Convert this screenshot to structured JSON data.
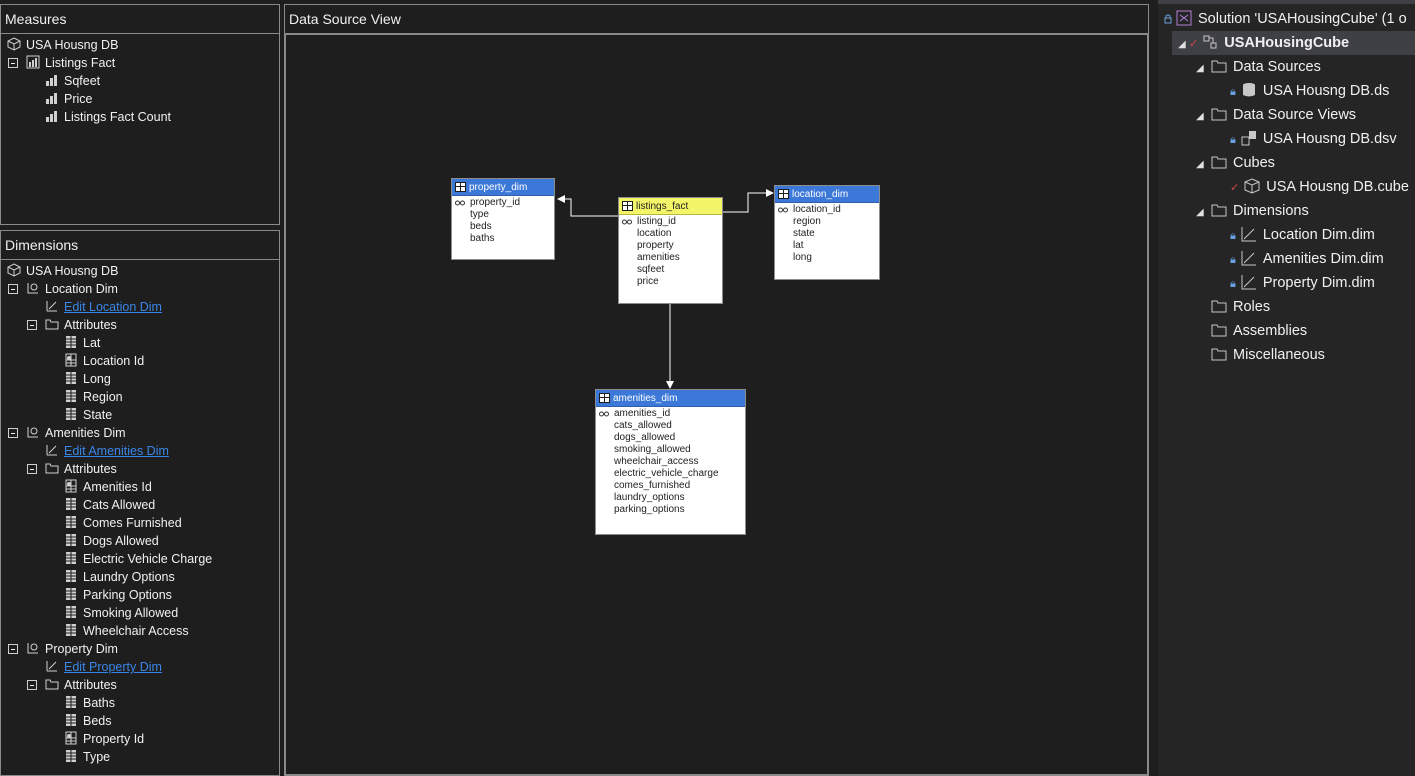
{
  "measures": {
    "header": "Measures",
    "db": "USA Housng DB",
    "group": "Listings Fact",
    "items": [
      "Sqfeet",
      "Price",
      "Listings Fact Count"
    ]
  },
  "dimensions": {
    "header": "Dimensions",
    "db": "USA Housng DB",
    "dims": [
      {
        "name": "Location Dim",
        "edit": "Edit Location Dim",
        "attributes_label": "Attributes",
        "attributes": [
          "Lat",
          "Location Id",
          "Long",
          "Region",
          "State"
        ]
      },
      {
        "name": "Amenities Dim",
        "edit": "Edit Amenities Dim",
        "attributes_label": "Attributes",
        "attributes": [
          "Amenities Id",
          "Cats Allowed",
          "Comes Furnished",
          "Dogs Allowed",
          "Electric Vehicle Charge",
          "Laundry Options",
          "Parking Options",
          "Smoking Allowed",
          "Wheelchair Access"
        ]
      },
      {
        "name": "Property Dim",
        "edit": "Edit Property Dim",
        "attributes_label": "Attributes",
        "attributes": [
          "Baths",
          "Beds",
          "Property Id",
          "Type"
        ]
      }
    ]
  },
  "dsv": {
    "header": "Data Source View",
    "tables": {
      "property_dim": {
        "name": "property_dim",
        "cols": [
          "property_id",
          "type",
          "beds",
          "baths"
        ]
      },
      "listings_fact": {
        "name": "listings_fact",
        "cols": [
          "listing_id",
          "location",
          "property",
          "amenities",
          "sqfeet",
          "price"
        ]
      },
      "location_dim": {
        "name": "location_dim",
        "cols": [
          "location_id",
          "region",
          "state",
          "lat",
          "long"
        ]
      },
      "amenities_dim": {
        "name": "amenities_dim",
        "cols": [
          "amenities_id",
          "cats_allowed",
          "dogs_allowed",
          "smoking_allowed",
          "wheelchair_access",
          "electric_vehicle_charge",
          "comes_furnished",
          "laundry_options",
          "parking_options"
        ]
      }
    }
  },
  "solution": {
    "title": "Solution 'USAHousingCube' (1 o",
    "project": "USAHousingCube",
    "folders": {
      "data_sources": "Data Sources",
      "ds_item": "USA Housng DB.ds",
      "dsv": "Data Source Views",
      "dsv_item": "USA Housng DB.dsv",
      "cubes": "Cubes",
      "cube_item": "USA Housng DB.cube",
      "dimensions": "Dimensions",
      "dim_items": [
        "Location Dim.dim",
        "Amenities Dim.dim",
        "Property Dim.dim"
      ],
      "roles": "Roles",
      "assemblies": "Assemblies",
      "misc": "Miscellaneous"
    }
  },
  "colors": {
    "background": "#1e1e1e",
    "link": "#3a86e8",
    "table_header": "#3c78d8",
    "fact_header": "#f5f56a"
  }
}
